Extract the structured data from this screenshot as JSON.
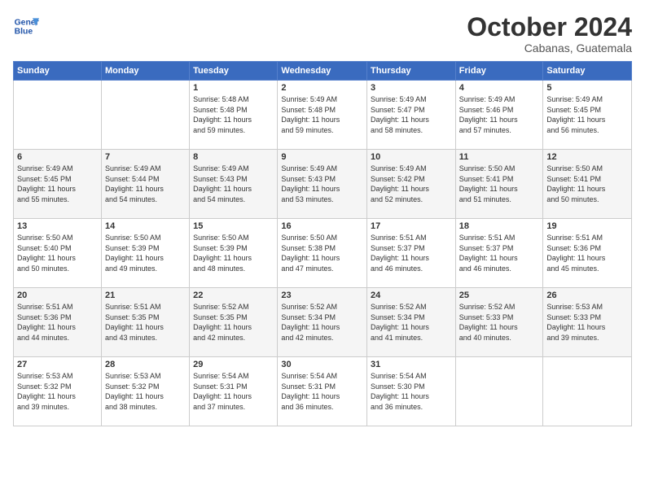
{
  "header": {
    "logo_line1": "General",
    "logo_line2": "Blue",
    "month": "October 2024",
    "location": "Cabanas, Guatemala"
  },
  "days_of_week": [
    "Sunday",
    "Monday",
    "Tuesday",
    "Wednesday",
    "Thursday",
    "Friday",
    "Saturday"
  ],
  "weeks": [
    [
      {
        "day": "",
        "content": ""
      },
      {
        "day": "",
        "content": ""
      },
      {
        "day": "1",
        "content": "Sunrise: 5:48 AM\nSunset: 5:48 PM\nDaylight: 11 hours\nand 59 minutes."
      },
      {
        "day": "2",
        "content": "Sunrise: 5:49 AM\nSunset: 5:48 PM\nDaylight: 11 hours\nand 59 minutes."
      },
      {
        "day": "3",
        "content": "Sunrise: 5:49 AM\nSunset: 5:47 PM\nDaylight: 11 hours\nand 58 minutes."
      },
      {
        "day": "4",
        "content": "Sunrise: 5:49 AM\nSunset: 5:46 PM\nDaylight: 11 hours\nand 57 minutes."
      },
      {
        "day": "5",
        "content": "Sunrise: 5:49 AM\nSunset: 5:45 PM\nDaylight: 11 hours\nand 56 minutes."
      }
    ],
    [
      {
        "day": "6",
        "content": "Sunrise: 5:49 AM\nSunset: 5:45 PM\nDaylight: 11 hours\nand 55 minutes."
      },
      {
        "day": "7",
        "content": "Sunrise: 5:49 AM\nSunset: 5:44 PM\nDaylight: 11 hours\nand 54 minutes."
      },
      {
        "day": "8",
        "content": "Sunrise: 5:49 AM\nSunset: 5:43 PM\nDaylight: 11 hours\nand 54 minutes."
      },
      {
        "day": "9",
        "content": "Sunrise: 5:49 AM\nSunset: 5:43 PM\nDaylight: 11 hours\nand 53 minutes."
      },
      {
        "day": "10",
        "content": "Sunrise: 5:49 AM\nSunset: 5:42 PM\nDaylight: 11 hours\nand 52 minutes."
      },
      {
        "day": "11",
        "content": "Sunrise: 5:50 AM\nSunset: 5:41 PM\nDaylight: 11 hours\nand 51 minutes."
      },
      {
        "day": "12",
        "content": "Sunrise: 5:50 AM\nSunset: 5:41 PM\nDaylight: 11 hours\nand 50 minutes."
      }
    ],
    [
      {
        "day": "13",
        "content": "Sunrise: 5:50 AM\nSunset: 5:40 PM\nDaylight: 11 hours\nand 50 minutes."
      },
      {
        "day": "14",
        "content": "Sunrise: 5:50 AM\nSunset: 5:39 PM\nDaylight: 11 hours\nand 49 minutes."
      },
      {
        "day": "15",
        "content": "Sunrise: 5:50 AM\nSunset: 5:39 PM\nDaylight: 11 hours\nand 48 minutes."
      },
      {
        "day": "16",
        "content": "Sunrise: 5:50 AM\nSunset: 5:38 PM\nDaylight: 11 hours\nand 47 minutes."
      },
      {
        "day": "17",
        "content": "Sunrise: 5:51 AM\nSunset: 5:37 PM\nDaylight: 11 hours\nand 46 minutes."
      },
      {
        "day": "18",
        "content": "Sunrise: 5:51 AM\nSunset: 5:37 PM\nDaylight: 11 hours\nand 46 minutes."
      },
      {
        "day": "19",
        "content": "Sunrise: 5:51 AM\nSunset: 5:36 PM\nDaylight: 11 hours\nand 45 minutes."
      }
    ],
    [
      {
        "day": "20",
        "content": "Sunrise: 5:51 AM\nSunset: 5:36 PM\nDaylight: 11 hours\nand 44 minutes."
      },
      {
        "day": "21",
        "content": "Sunrise: 5:51 AM\nSunset: 5:35 PM\nDaylight: 11 hours\nand 43 minutes."
      },
      {
        "day": "22",
        "content": "Sunrise: 5:52 AM\nSunset: 5:35 PM\nDaylight: 11 hours\nand 42 minutes."
      },
      {
        "day": "23",
        "content": "Sunrise: 5:52 AM\nSunset: 5:34 PM\nDaylight: 11 hours\nand 42 minutes."
      },
      {
        "day": "24",
        "content": "Sunrise: 5:52 AM\nSunset: 5:34 PM\nDaylight: 11 hours\nand 41 minutes."
      },
      {
        "day": "25",
        "content": "Sunrise: 5:52 AM\nSunset: 5:33 PM\nDaylight: 11 hours\nand 40 minutes."
      },
      {
        "day": "26",
        "content": "Sunrise: 5:53 AM\nSunset: 5:33 PM\nDaylight: 11 hours\nand 39 minutes."
      }
    ],
    [
      {
        "day": "27",
        "content": "Sunrise: 5:53 AM\nSunset: 5:32 PM\nDaylight: 11 hours\nand 39 minutes."
      },
      {
        "day": "28",
        "content": "Sunrise: 5:53 AM\nSunset: 5:32 PM\nDaylight: 11 hours\nand 38 minutes."
      },
      {
        "day": "29",
        "content": "Sunrise: 5:54 AM\nSunset: 5:31 PM\nDaylight: 11 hours\nand 37 minutes."
      },
      {
        "day": "30",
        "content": "Sunrise: 5:54 AM\nSunset: 5:31 PM\nDaylight: 11 hours\nand 36 minutes."
      },
      {
        "day": "31",
        "content": "Sunrise: 5:54 AM\nSunset: 5:30 PM\nDaylight: 11 hours\nand 36 minutes."
      },
      {
        "day": "",
        "content": ""
      },
      {
        "day": "",
        "content": ""
      }
    ]
  ]
}
